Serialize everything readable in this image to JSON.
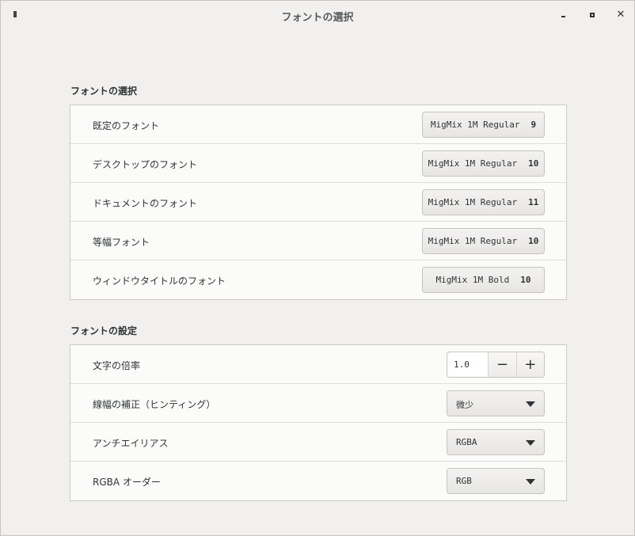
{
  "window": {
    "title": "フォントの選択"
  },
  "font_section": {
    "heading": "フォントの選択",
    "rows": [
      {
        "label": "既定のフォント",
        "font": "MigMix 1M Regular",
        "size": "9"
      },
      {
        "label": "デスクトップのフォント",
        "font": "MigMix 1M Regular",
        "size": "10"
      },
      {
        "label": "ドキュメントのフォント",
        "font": "MigMix 1M Regular",
        "size": "11"
      },
      {
        "label": "等幅フォント",
        "font": "MigMix 1M Regular",
        "size": "10"
      },
      {
        "label": "ウィンドウタイトルのフォント",
        "font": "MigMix 1M Bold",
        "size": "10"
      }
    ]
  },
  "settings_section": {
    "heading": "フォントの設定",
    "scale": {
      "label": "文字の倍率",
      "value": "1.0",
      "minus": "−",
      "plus": "+"
    },
    "hinting": {
      "label": "線幅の補正（ヒンティング）",
      "value": "微少"
    },
    "antialiasing": {
      "label": "アンチエイリアス",
      "value": "RGBA"
    },
    "rgba_order": {
      "label": "RGBA オーダー",
      "value": "RGB"
    }
  }
}
